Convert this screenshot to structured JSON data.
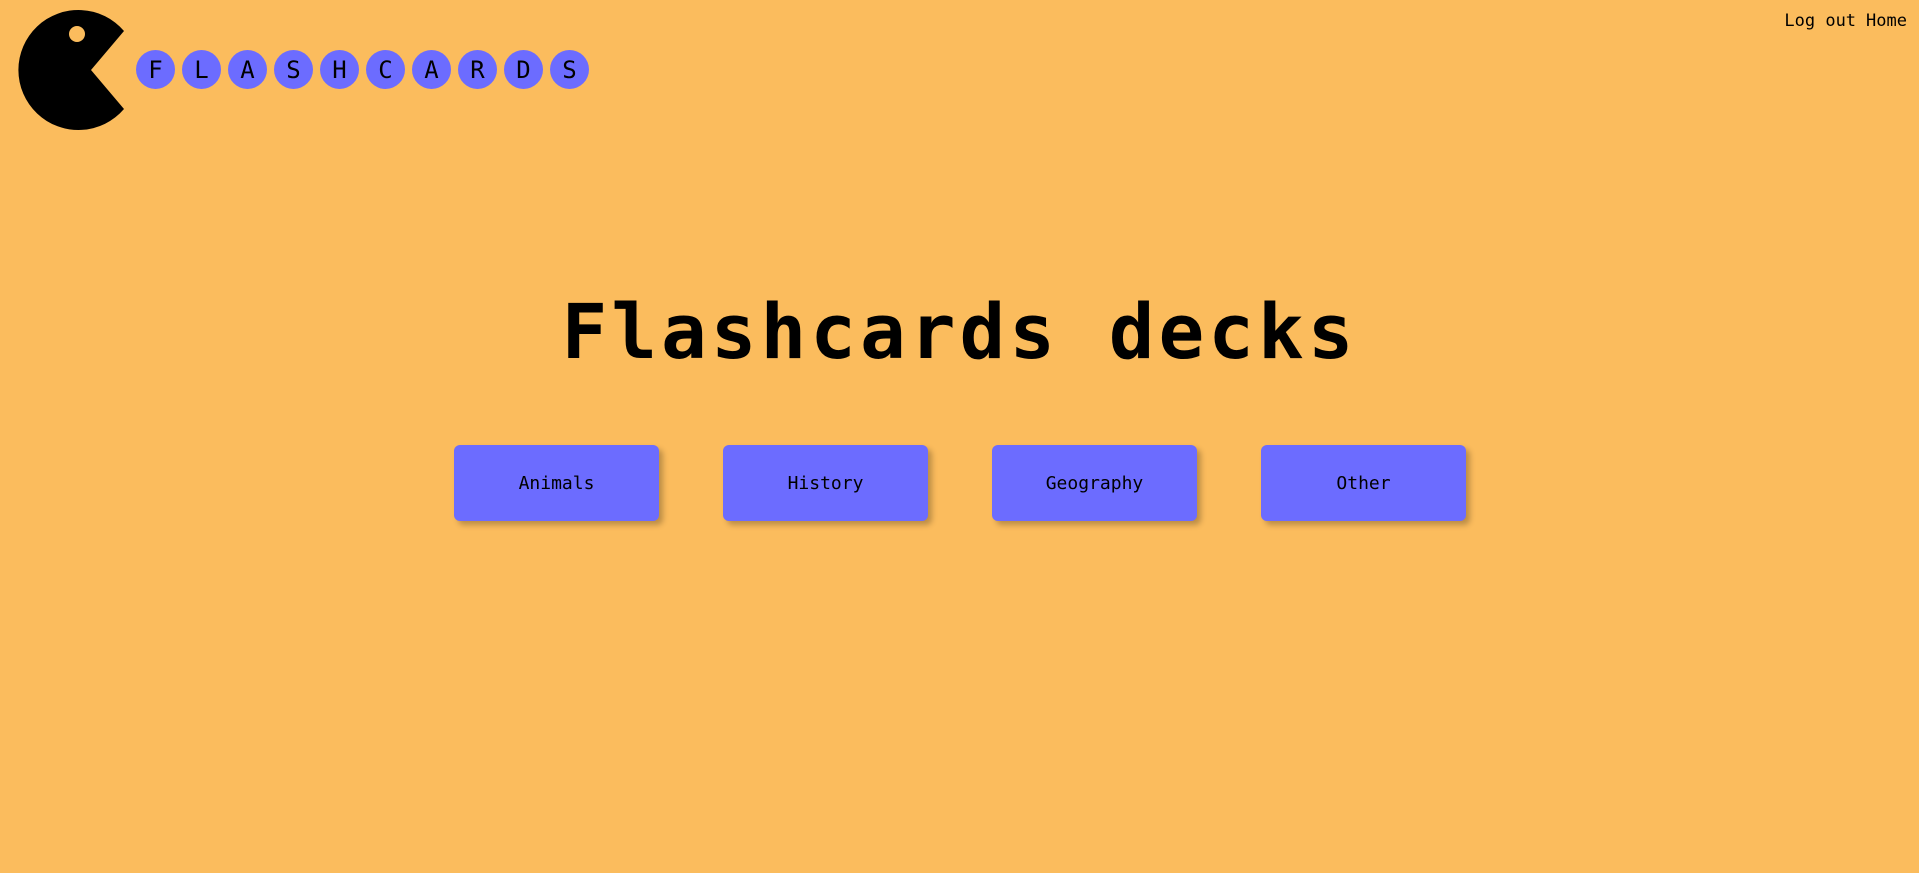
{
  "colors": {
    "background": "#FBBC5D",
    "accent": "#6C6CFF",
    "text": "#000000"
  },
  "logo": {
    "icon": "pacman-icon",
    "letters": [
      "F",
      "L",
      "A",
      "S",
      "H",
      "C",
      "A",
      "R",
      "D",
      "S"
    ]
  },
  "nav": {
    "logout_label": "Log out",
    "home_label": "Home"
  },
  "main": {
    "title": "Flashcards decks",
    "decks": [
      {
        "label": "Animals"
      },
      {
        "label": "History"
      },
      {
        "label": "Geography"
      },
      {
        "label": "Other"
      }
    ]
  }
}
